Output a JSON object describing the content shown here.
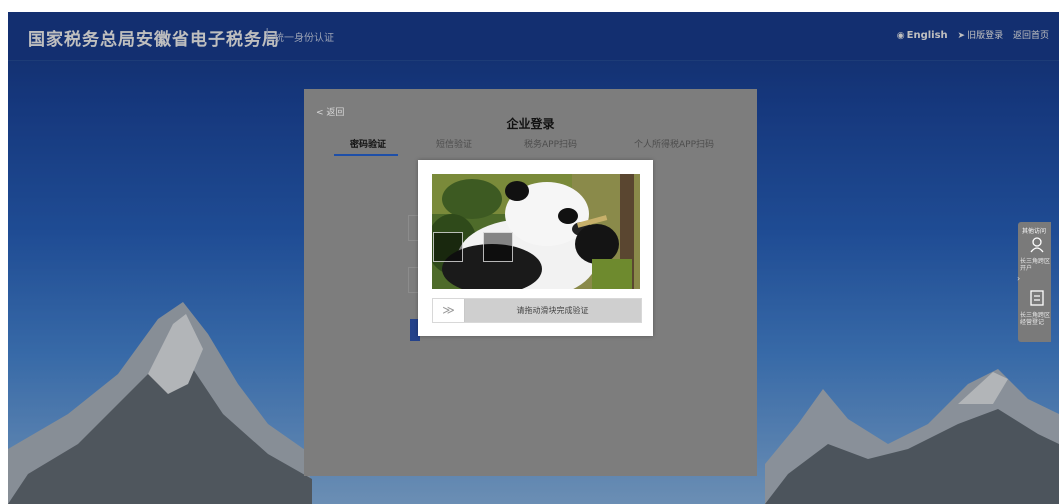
{
  "header": {
    "title": "国家税务总局安徽省电子税务局",
    "separator": "|",
    "subtitle": "统一身份认证",
    "english": "English",
    "old_login": "旧版登录",
    "back_home": "返回首页"
  },
  "login": {
    "back": "< 返回",
    "title": "企业登录",
    "tabs": [
      "密码验证",
      "短信验证",
      "税务APP扫码",
      "个人所得税APP扫码"
    ]
  },
  "captcha": {
    "image_subject": "panda-eating-bamboo",
    "slider_handle": "≫",
    "slider_text": "请拖动滑块完成验证",
    "slider_progress": 0
  },
  "side_panel": {
    "header": "其他访问",
    "item1_label": "长三角跨区开户",
    "item1_icon": "user-icon",
    "item2_label": "长三角跨区经营登记",
    "item2_icon": "form-icon"
  },
  "colors": {
    "header_bg": "#1a3f96",
    "tab_underline": "#1e4fa8",
    "modal_overlay": "#7d7d7d"
  }
}
